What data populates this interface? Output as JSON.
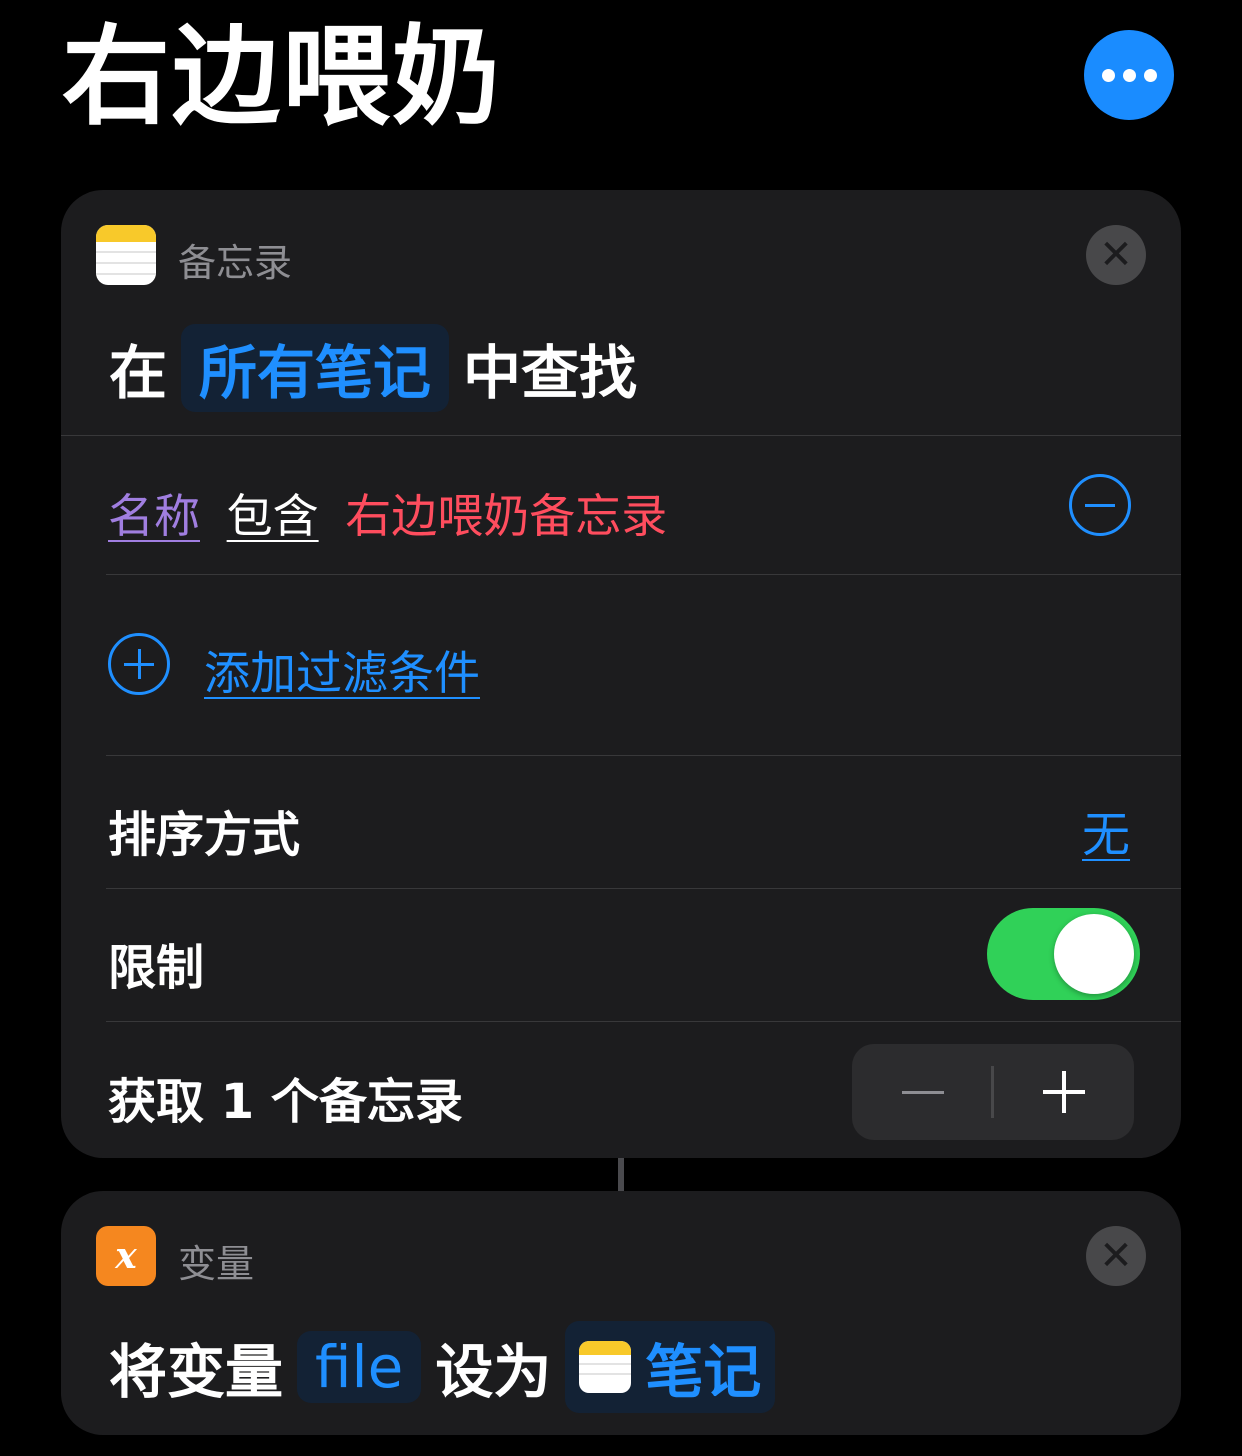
{
  "header": {
    "title": "右边喂奶"
  },
  "icons": {
    "more": "ellipsis-icon",
    "close": "close-icon",
    "notes_app": "notes-app-icon",
    "variable_app": "variable-x-icon",
    "remove_filter": "minus-circle-icon",
    "add_filter": "plus-circle-icon"
  },
  "colors": {
    "accent": "#1f8fff",
    "toggle_on": "#30d158",
    "filter_property": "#a07ee0",
    "filter_value": "#ff4d5e",
    "variable_icon": "#f5871f",
    "notes_icon_band": "#f8c92a"
  },
  "find_notes_action": {
    "app_name": "备忘录",
    "sentence": {
      "prefix": "在",
      "source_token": "所有笔记",
      "suffix": "中查找"
    },
    "filter": {
      "property": "名称",
      "operator": "包含",
      "value": "右边喂奶备忘录"
    },
    "add_filter_label": "添加过滤条件",
    "sort": {
      "label": "排序方式",
      "value": "无"
    },
    "limit": {
      "label": "限制",
      "enabled": true
    },
    "get_count": {
      "label": "获取 1 个备忘录",
      "count": 1
    }
  },
  "set_variable_action": {
    "app_name": "变量",
    "icon_glyph": "x",
    "sentence": {
      "prefix": "将变量",
      "variable_token": "file",
      "middle": "设为",
      "value_token": "笔记"
    }
  }
}
